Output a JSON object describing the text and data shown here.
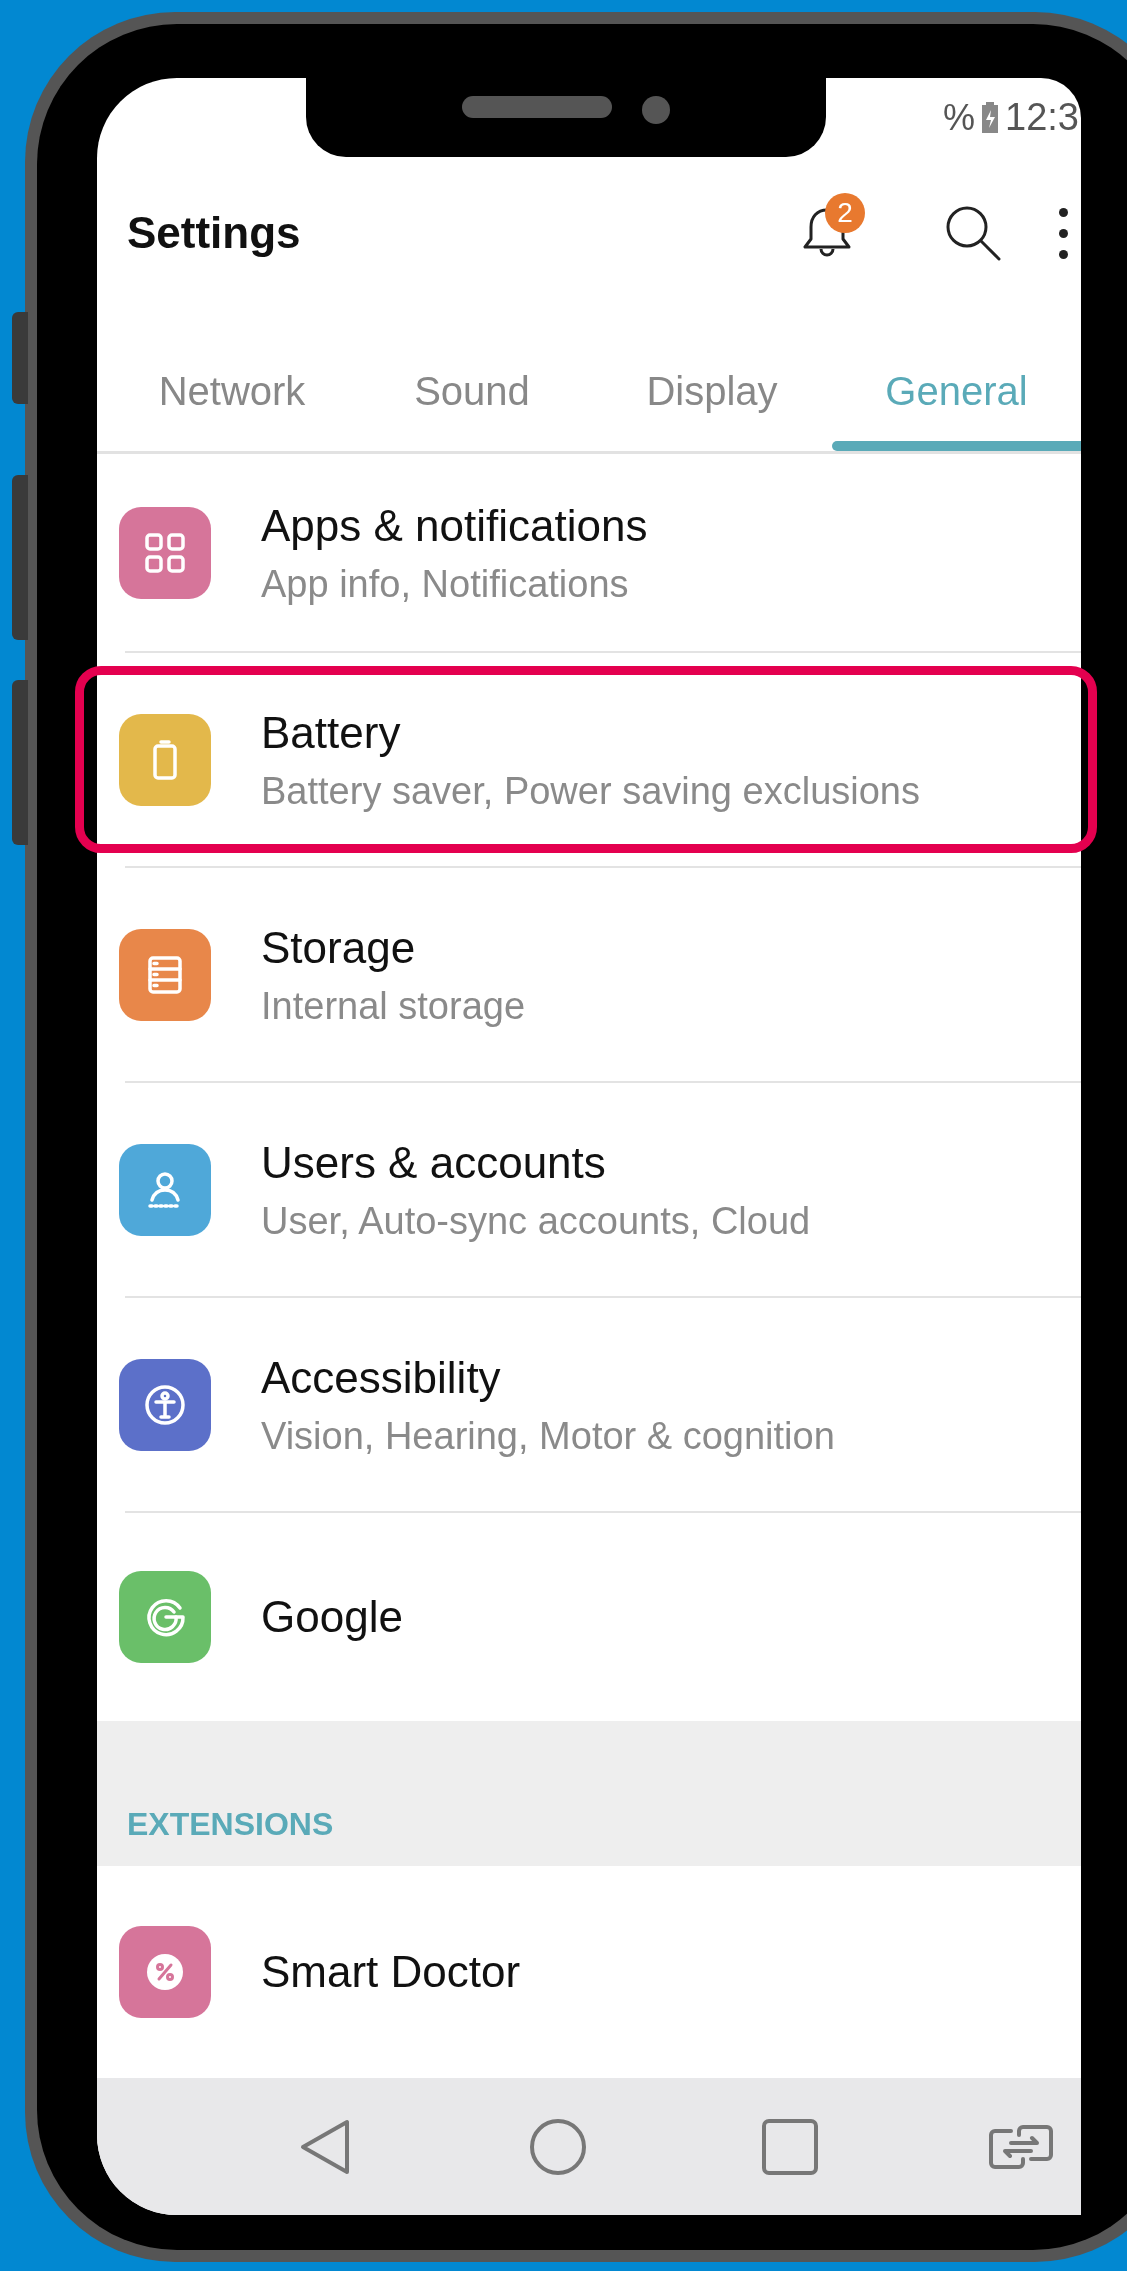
{
  "status_bar": {
    "battery_sign": "%",
    "time": "12:3"
  },
  "header": {
    "title": "Settings",
    "notification_count": "2"
  },
  "tabs": [
    {
      "label": "Network",
      "selected": false
    },
    {
      "label": "Sound",
      "selected": false
    },
    {
      "label": "Display",
      "selected": false
    },
    {
      "label": "General",
      "selected": true
    }
  ],
  "items": [
    {
      "kind": "apps",
      "title": "Apps & notifications",
      "subtitle": "App info, Notifications",
      "color": "#d6759a",
      "highlighted": false
    },
    {
      "kind": "battery",
      "title": "Battery",
      "subtitle": "Battery saver, Power saving exclusions",
      "color": "#e3b84b",
      "highlighted": true
    },
    {
      "kind": "storage",
      "title": "Storage",
      "subtitle": "Internal storage",
      "color": "#e8874a",
      "highlighted": false
    },
    {
      "kind": "user",
      "title": "Users & accounts",
      "subtitle": "User, Auto-sync accounts, Cloud",
      "color": "#4fa8d9",
      "highlighted": false
    },
    {
      "kind": "accessibility",
      "title": "Accessibility",
      "subtitle": "Vision, Hearing, Motor & cognition",
      "color": "#5c70c9",
      "highlighted": false
    },
    {
      "kind": "google",
      "title": "Google",
      "color": "#6abf69",
      "highlighted": false
    }
  ],
  "extensions": {
    "heading": "EXTENSIONS",
    "items": [
      {
        "kind": "doctor",
        "title": "Smart Doctor",
        "color": "#d6759a",
        "highlighted": false
      }
    ]
  }
}
